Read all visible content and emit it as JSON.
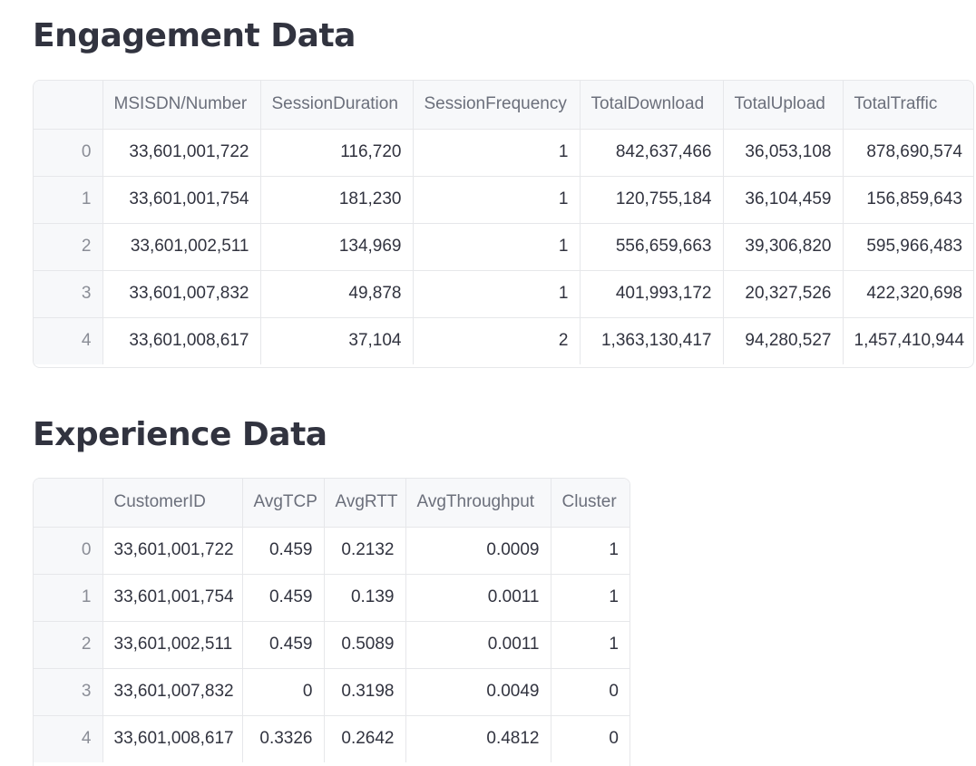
{
  "engagement": {
    "title": "Engagement Data",
    "columns": [
      "",
      "MSISDN/Number",
      "SessionDuration",
      "SessionFrequency",
      "TotalDownload",
      "TotalUpload",
      "TotalTraffic"
    ],
    "rows": [
      [
        "0",
        "33,601,001,722",
        "116,720",
        "1",
        "842,637,466",
        "36,053,108",
        "878,690,574"
      ],
      [
        "1",
        "33,601,001,754",
        "181,230",
        "1",
        "120,755,184",
        "36,104,459",
        "156,859,643"
      ],
      [
        "2",
        "33,601,002,511",
        "134,969",
        "1",
        "556,659,663",
        "39,306,820",
        "595,966,483"
      ],
      [
        "3",
        "33,601,007,832",
        "49,878",
        "1",
        "401,993,172",
        "20,327,526",
        "422,320,698"
      ],
      [
        "4",
        "33,601,008,617",
        "37,104",
        "2",
        "1,363,130,417",
        "94,280,527",
        "1,457,410,944"
      ]
    ]
  },
  "experience": {
    "title": "Experience Data",
    "columns": [
      "",
      "CustomerID",
      "AvgTCP",
      "AvgRTT",
      "AvgThroughput",
      "Cluster"
    ],
    "rows": [
      [
        "0",
        "33,601,001,722",
        "0.459",
        "0.2132",
        "0.0009",
        "1"
      ],
      [
        "1",
        "33,601,001,754",
        "0.459",
        "0.139",
        "0.0011",
        "1"
      ],
      [
        "2",
        "33,601,002,511",
        "0.459",
        "0.5089",
        "0.0011",
        "1"
      ],
      [
        "3",
        "33,601,007,832",
        "0",
        "0.3198",
        "0.0049",
        "0"
      ],
      [
        "4",
        "33,601,008,617",
        "0.3326",
        "0.2642",
        "0.4812",
        "0"
      ]
    ]
  }
}
